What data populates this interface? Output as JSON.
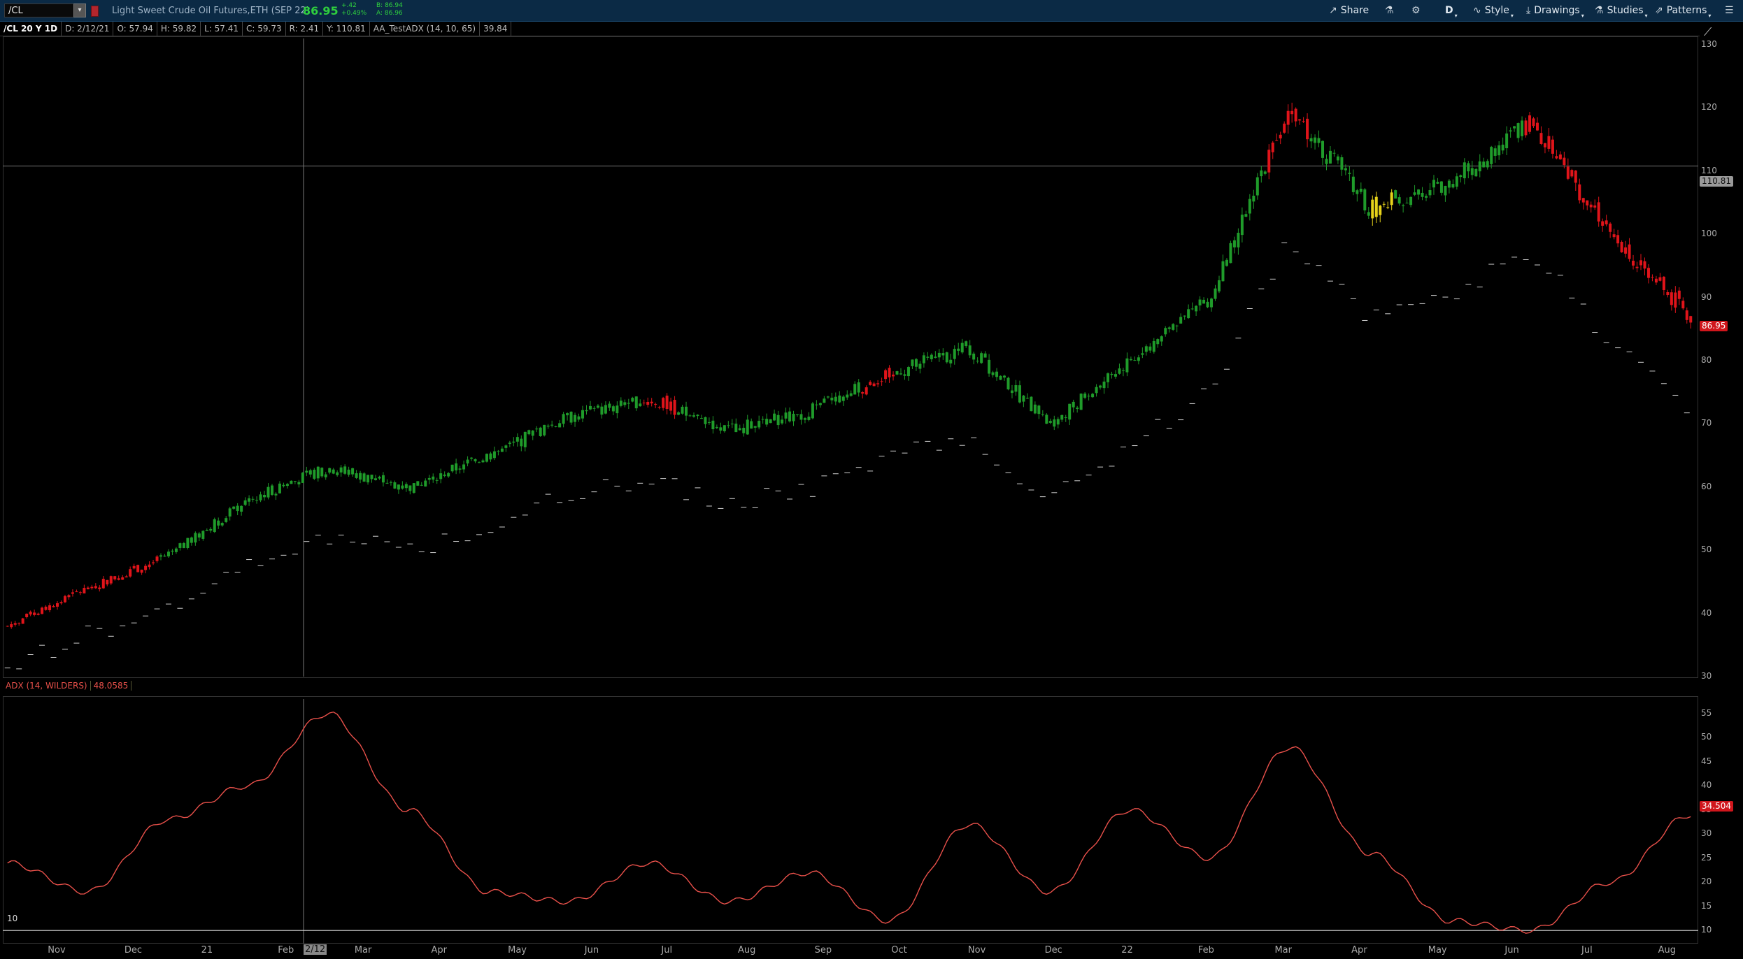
{
  "header": {
    "symbol": "/CL",
    "description": "Light Sweet Crude Oil Futures,ETH (SEP 22)",
    "last_price": "86.95",
    "change": "+.42",
    "change_pct": "+0.49%",
    "bid": "B: 86.94",
    "ask": "A: 86.96",
    "toolbar": {
      "share": "Share",
      "timeframe": "D",
      "style": "Style",
      "drawings": "Drawings",
      "studies": "Studies",
      "patterns": "Patterns"
    }
  },
  "infobar": {
    "aggregation": "/CL 20 Y 1D",
    "date": "D: 2/12/21",
    "open": "O: 57.94",
    "high": "H: 59.82",
    "low": "L: 57.41",
    "close": "C: 59.73",
    "range": "R: 2.41",
    "cursor_y": "Y: 110.81",
    "study": "AA_TestADX (14, 10, 65)",
    "study_value": "39.84"
  },
  "price_axis": {
    "ticks": [
      "130",
      "120",
      "110",
      "100",
      "90",
      "80",
      "70",
      "60",
      "50",
      "40",
      "30"
    ],
    "cursor_label": "110.81",
    "last_label": "86.95"
  },
  "adx": {
    "label": "ADX (14, WILDERS)",
    "value": "48.0585",
    "ticks": [
      "55",
      "50",
      "45",
      "40",
      "35",
      "30",
      "25",
      "20",
      "15",
      "10"
    ],
    "last_label": "34.504",
    "threshold_label": "10"
  },
  "time_axis": {
    "labels": [
      "Nov",
      "Dec",
      "21",
      "Feb",
      "Mar",
      "Apr",
      "May",
      "Jun",
      "Jul",
      "Aug",
      "Sep",
      "Oct",
      "Nov",
      "Dec",
      "22",
      "Feb",
      "Mar",
      "Apr",
      "May",
      "Jun",
      "Jul",
      "Aug"
    ],
    "cursor_label": "2/12"
  },
  "colors": {
    "up": "#1f9b2a",
    "down": "#e0141a",
    "warn": "#e6d21a",
    "adx_line": "#e8504a",
    "toolbar_bg": "#0b2a45"
  },
  "chart_data": {
    "type": "candlestick",
    "ylim": [
      30,
      131
    ],
    "close_series": {
      "name": "/CL",
      "x": [
        "Nov",
        "Dec",
        "21",
        "Feb",
        "Mar",
        "Apr",
        "May",
        "Jun",
        "Jul",
        "Aug",
        "Sep",
        "Oct",
        "Nov",
        "Dec",
        "22",
        "Feb",
        "Mar",
        "Apr",
        "May",
        "Jun",
        "Jul",
        "Aug"
      ],
      "values": [
        38,
        44,
        49,
        58,
        63,
        60,
        65,
        71,
        74,
        69,
        72,
        78,
        82,
        70,
        80,
        90,
        120,
        104,
        108,
        118,
        100,
        87
      ]
    },
    "adx_series": {
      "name": "ADX (14, WILDERS)",
      "ylim": [
        8,
        58
      ],
      "threshold": 10,
      "values": [
        24,
        18,
        33,
        40,
        55,
        35,
        18,
        16,
        24,
        16,
        22,
        12,
        32,
        18,
        35,
        25,
        48,
        26,
        12,
        10,
        20,
        34
      ]
    }
  }
}
